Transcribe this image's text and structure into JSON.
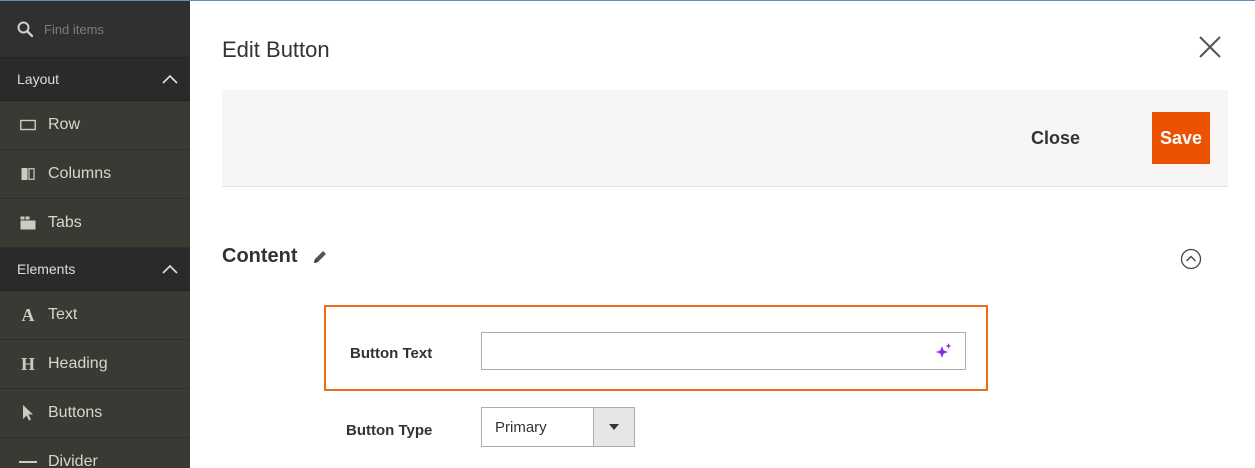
{
  "sidebar": {
    "search_placeholder": "Find items",
    "groups": [
      {
        "label": "Layout",
        "items": [
          {
            "label": "Row",
            "icon": "row-icon"
          },
          {
            "label": "Columns",
            "icon": "columns-icon"
          },
          {
            "label": "Tabs",
            "icon": "tabs-icon"
          }
        ]
      },
      {
        "label": "Elements",
        "items": [
          {
            "label": "Text",
            "icon_glyph": "A"
          },
          {
            "label": "Heading",
            "icon_glyph": "H"
          },
          {
            "label": "Buttons",
            "icon": "cursor-icon"
          },
          {
            "label": "Divider",
            "icon": "divider-icon"
          }
        ]
      }
    ]
  },
  "modal": {
    "title": "Edit Button",
    "toolbar": {
      "close_label": "Close",
      "save_label": "Save"
    },
    "section": {
      "title": "Content"
    },
    "fields": {
      "button_text": {
        "label": "Button Text",
        "value": ""
      },
      "button_type": {
        "label": "Button Type",
        "value": "Primary"
      }
    }
  },
  "colors": {
    "accent": "#eb5202",
    "highlight_border": "#eb6a1e",
    "sidebar_bg": "#3b3b35",
    "sparkle": "#8a2be2"
  }
}
